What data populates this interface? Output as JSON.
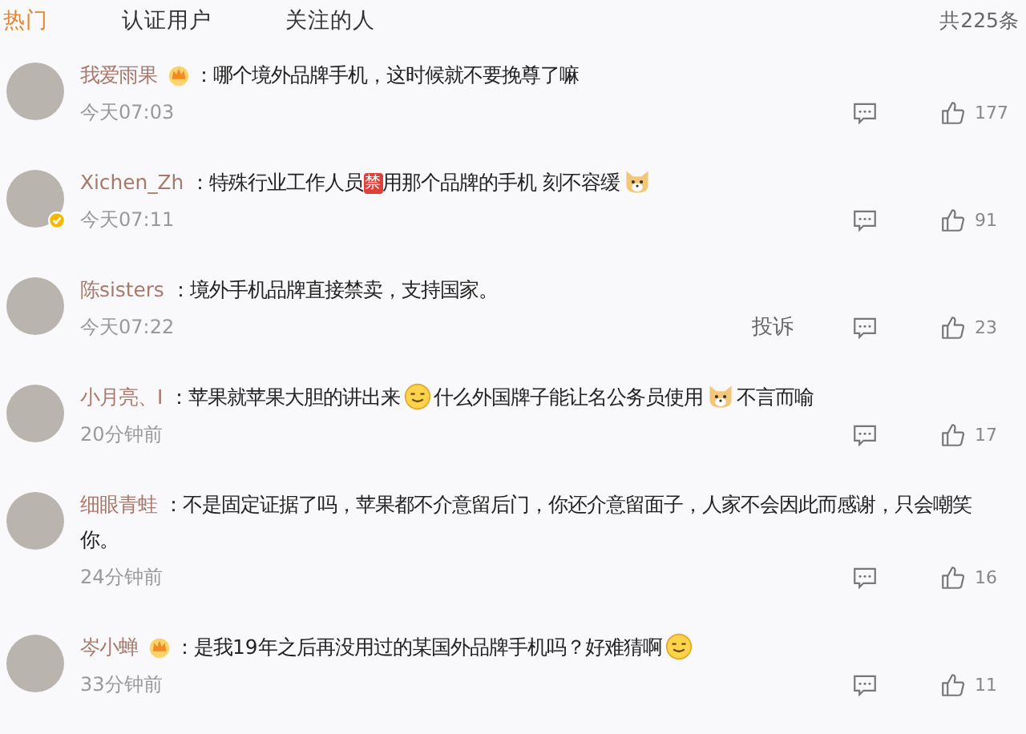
{
  "tabs": [
    {
      "label": "热门",
      "selected": true
    },
    {
      "label": "认证用户",
      "selected": false
    },
    {
      "label": "关注的人",
      "selected": false
    }
  ],
  "total": "共225条",
  "comments": [
    {
      "user": "我爱雨果",
      "crown": true,
      "verified": false,
      "content": [
        {
          "kind": "text",
          "text": "：哪个境外品牌手机，这时候就不要挽尊了嘛"
        }
      ],
      "time": "今天07:03",
      "likes": "177"
    },
    {
      "user": "Xichen_Zh",
      "crown": false,
      "verified": true,
      "content": [
        {
          "kind": "text",
          "text": "：特殊行业工作人员"
        },
        {
          "kind": "label",
          "text": "禁"
        },
        {
          "kind": "text",
          "text": "用那个品牌的手机 刻不容缓"
        },
        {
          "kind": "dog"
        }
      ],
      "time": "今天07:11",
      "likes": "91"
    },
    {
      "user": "陈sisters",
      "crown": false,
      "verified": false,
      "content": [
        {
          "kind": "text",
          "text": "：境外手机品牌直接禁卖，支持国家。"
        }
      ],
      "time": "今天07:22",
      "report": "投诉",
      "likes": "23"
    },
    {
      "user": "小月亮、I",
      "crown": false,
      "verified": false,
      "content": [
        {
          "kind": "text",
          "text": "：苹果就苹果大胆的讲出来"
        },
        {
          "kind": "smiley"
        },
        {
          "kind": "text",
          "text": "什么外国牌子能让名公务员使用"
        },
        {
          "kind": "dog"
        },
        {
          "kind": "text",
          "text": "不言而喻"
        }
      ],
      "time": "20分钟前",
      "likes": "17"
    },
    {
      "user": "细眼青蛙",
      "crown": false,
      "verified": false,
      "content": [
        {
          "kind": "text",
          "text": "：不是固定证据了吗，苹果都不介意留后门，你还介意留面子，人家不会因此而感谢，只会嘲笑"
        },
        {
          "kind": "line",
          "text": "你。"
        }
      ],
      "time": "24分钟前",
      "likes": "16"
    },
    {
      "user": "岑小蝉",
      "crown": true,
      "verified": false,
      "content": [
        {
          "kind": "text",
          "text": "：是我19年之后再没用过的某国外品牌手机吗？好难猜啊"
        },
        {
          "kind": "smiley"
        }
      ],
      "time": "33分钟前",
      "likes": "11"
    }
  ]
}
